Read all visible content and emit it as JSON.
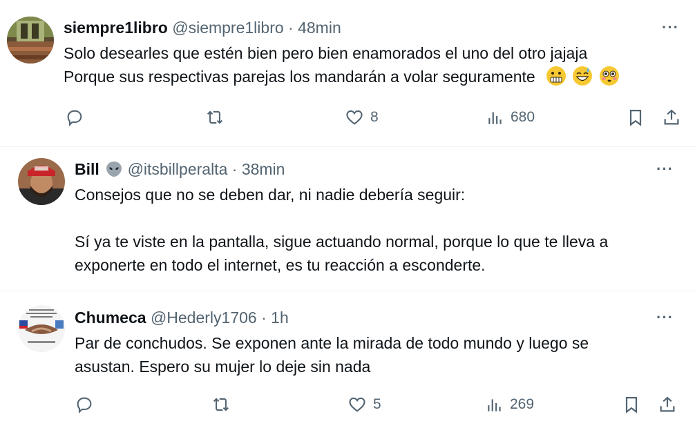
{
  "tweets": [
    {
      "name": "siempre1libro",
      "handle": "@siempre1libro",
      "time": "48min",
      "lines": [
        "Solo desearles que estén bien pero bien enamorados el uno del otro jajaja",
        "Porque sus respectivas parejas los mandarán a volar seguramente"
      ],
      "emojis": [
        "grimacing-face",
        "grinning-sweat-face",
        "flushed-face"
      ],
      "replies": "",
      "retweets": "",
      "likes": "8",
      "views": "680"
    },
    {
      "name": "Bill",
      "name_emoji": "alien-emoji",
      "handle": "@itsbillperalta",
      "time": "38min",
      "lines": [
        "Consejos que no se deben dar, ni nadie debería seguir:",
        "",
        "Sí ya te viste en la pantalla, sigue actuando normal, porque lo que te lleva a",
        "exponerte en todo el internet, es tu reacción a esconderte."
      ]
    },
    {
      "name": "Chumeca",
      "handle": "@Hederly1706",
      "time": "1h",
      "lines": [
        "Par de conchudos. Se exponen ante la mirada de todo mundo y luego se",
        "asustan. Espero su mujer lo deje sin nada"
      ],
      "replies": "",
      "retweets": "",
      "likes": "5",
      "views": "269"
    }
  ],
  "separator": "·",
  "more_label": "···",
  "colors": {
    "text": "#0f1419",
    "secondary": "#536471",
    "divider": "#eff3f4"
  }
}
